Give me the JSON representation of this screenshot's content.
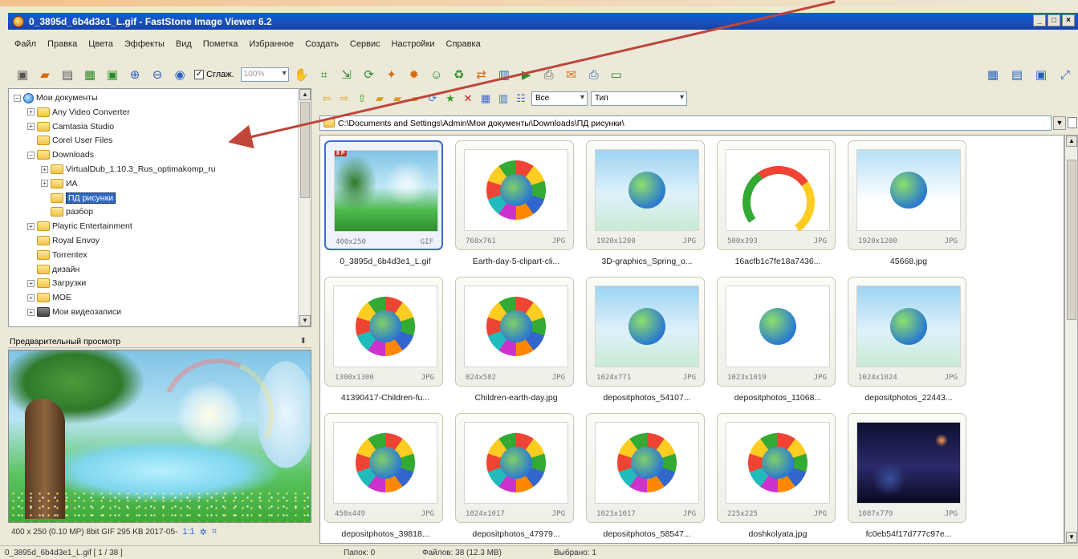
{
  "window": {
    "title": "0_3895d_6b4d3e1_L.gif  -  FastStone Image Viewer 6.2",
    "controls": [
      "_",
      "□",
      "×"
    ]
  },
  "menu": [
    "Файл",
    "Правка",
    "Цвета",
    "Эффекты",
    "Вид",
    "Пометка",
    "Избранное",
    "Создать",
    "Сервис",
    "Настройки",
    "Справка"
  ],
  "toolbar": {
    "smooth_label": "Сглаж.",
    "zoom_value": "100%",
    "icons": [
      "camera-icon",
      "open-folder-icon",
      "save-icon",
      "save-as-icon",
      "fit-icon",
      "zoom-in-icon",
      "zoom-out-icon",
      "actual-size-icon"
    ]
  },
  "tree": {
    "items": [
      {
        "label": "Мои документы",
        "level": 0,
        "icon": "globe",
        "expander": "−"
      },
      {
        "label": "Any Video Converter",
        "level": 1,
        "icon": "folder",
        "expander": "+"
      },
      {
        "label": "Camtasia Studio",
        "level": 1,
        "icon": "folder",
        "expander": "+"
      },
      {
        "label": "Corel User Files",
        "level": 1,
        "icon": "folder",
        "expander": ""
      },
      {
        "label": "Downloads",
        "level": 1,
        "icon": "folder",
        "expander": "−"
      },
      {
        "label": "VirtualDub_1.10.3_Rus_optimakomp_ru",
        "level": 2,
        "icon": "folder",
        "expander": "+"
      },
      {
        "label": "ИА",
        "level": 2,
        "icon": "folder",
        "expander": "+"
      },
      {
        "label": "ПД рисунки",
        "level": 2,
        "icon": "folder",
        "expander": "",
        "selected": true
      },
      {
        "label": "разбор",
        "level": 2,
        "icon": "folder",
        "expander": ""
      },
      {
        "label": "Playric Entertainment",
        "level": 1,
        "icon": "folder",
        "expander": "+"
      },
      {
        "label": "Royal Envoy",
        "level": 1,
        "icon": "folder",
        "expander": ""
      },
      {
        "label": "Torrentex",
        "level": 1,
        "icon": "folder",
        "expander": ""
      },
      {
        "label": "дизайн",
        "level": 1,
        "icon": "folder",
        "expander": ""
      },
      {
        "label": "Загрузки",
        "level": 1,
        "icon": "folder",
        "expander": "+"
      },
      {
        "label": "МОЕ",
        "level": 1,
        "icon": "folder",
        "expander": "+"
      },
      {
        "label": "Мои видеозаписи",
        "level": 1,
        "icon": "film",
        "expander": "+"
      }
    ]
  },
  "preview": {
    "title": "Предварительный просмотр",
    "pin": "ꟷ",
    "info": "400 x 250 (0.10 MP)  8bit  GIF   295 KB   2017-05-",
    "zoom": "1:1"
  },
  "browser": {
    "filter_value": "Все",
    "sort_value": "Тип",
    "path": "C:\\Documents and Settings\\Admin\\Мои документы\\Downloads\\ПД рисунки\\"
  },
  "thumbnails": [
    {
      "dims": "400x250",
      "type": "GIF",
      "name": "0_3895d_6b4d3e1_L.gif",
      "style": "img-rainbow-pond",
      "selected": true,
      "badge": "8 P"
    },
    {
      "dims": "768x761",
      "type": "JPG",
      "name": "Earth-day-5-clipart-cli...",
      "style": "img-circle",
      "art": "ring"
    },
    {
      "dims": "1920x1200",
      "type": "JPG",
      "name": "3D-graphics_Spring_o...",
      "style": "img-sky",
      "art": "globe"
    },
    {
      "dims": "500x393",
      "type": "JPG",
      "name": "16acfb1c7fe18a7436...",
      "style": "img-rainbow-kids",
      "art": "rainbow"
    },
    {
      "dims": "1920x1200",
      "type": "JPG",
      "name": "45668.jpg",
      "style": "img-cloud",
      "art": "globe"
    },
    {
      "dims": "1300x1300",
      "type": "JPG",
      "name": "41390417-Children-fu...",
      "style": "img-circle",
      "art": "ring"
    },
    {
      "dims": "824x582",
      "type": "JPG",
      "name": "Children-earth-day.jpg",
      "style": "img-circle",
      "art": "ring"
    },
    {
      "dims": "1024x771",
      "type": "JPG",
      "name": "depositphotos_54107...",
      "style": "img-sky",
      "art": "globe"
    },
    {
      "dims": "1023x1019",
      "type": "JPG",
      "name": "depositphotos_11068...",
      "style": "img-circle",
      "art": "globe"
    },
    {
      "dims": "1024x1024",
      "type": "JPG",
      "name": "depositphotos_22443...",
      "style": "img-sky",
      "art": "globe"
    },
    {
      "dims": "450x449",
      "type": "JPG",
      "name": "depositphotos_39818...",
      "style": "img-circle",
      "art": "ring"
    },
    {
      "dims": "1024x1017",
      "type": "JPG",
      "name": "depositphotos_47979...",
      "style": "img-circle",
      "art": "ring"
    },
    {
      "dims": "1023x1017",
      "type": "JPG",
      "name": "depositphotos_58547...",
      "style": "img-circle",
      "art": "ring"
    },
    {
      "dims": "225x225",
      "type": "JPG",
      "name": "doshkolyata.jpg",
      "style": "img-circle",
      "art": "ring"
    },
    {
      "dims": "1087x779",
      "type": "JPG",
      "name": "fc0eb54f17d777c97e...",
      "style": "img-space",
      "art": ""
    }
  ],
  "status": {
    "file": "0_3895d_6b4d3e1_L.gif [ 1 / 38 ]",
    "folders": "Папок: 0",
    "files": "Файлов: 38 (12.3 MB)",
    "selected": "Выбрано: 1"
  },
  "colors": {
    "titlebar": "#1c4fb8",
    "selection": "#316ac5",
    "annotation_arrow": "#c0453a"
  }
}
